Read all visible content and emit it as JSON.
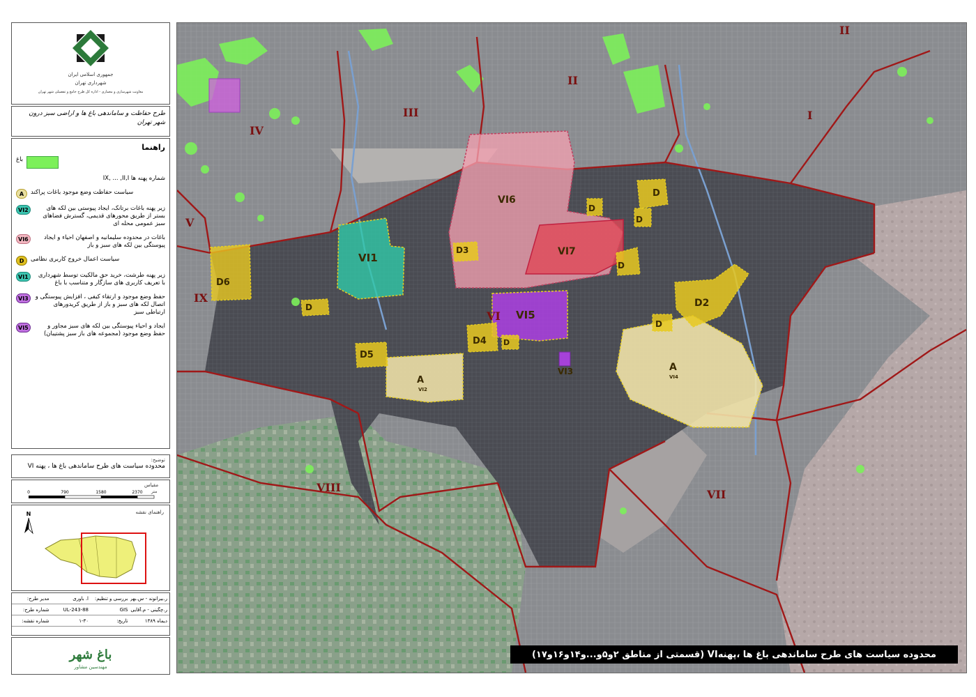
{
  "legend": {
    "logo_lines": [
      "جمهوری اسلامی ایران",
      "شهرداری تهران",
      "معاونت شهرسازی و معماری - اداره کل طرح جامع و تفصیلی شهر تهران"
    ],
    "plan_title": "طرح حفاظت و ساماندهی باغ ها و اراضی سبز درون شهر تهران",
    "heading": "راهنما",
    "garden_label": "باغ",
    "zone_numbers_label": "IX, ... ,II,I  شماره پهنه ها",
    "items": [
      {
        "code": "A",
        "text": "سیاست حفاظت وضع موجود باغات پراکند",
        "color": "#e8dfa0",
        "border": "#b8a030"
      },
      {
        "code": "VI2",
        "text": "زیر پهنه باغات برتانک، ایجاد پیوستی بین لکه های بستر از طریق محورهای قدیمی، گسترش فضاهای سبز عمومی محله ای",
        "color": "#3cc4b0",
        "border": "#1a8a7a"
      },
      {
        "code": "VI6",
        "text": "باغات در محدوده سلیمانیه و اصفهان احیاء و ایجاد پیوستگی بین لکه های سبز و باز",
        "color": "#f2b6c0",
        "border": "#c07080"
      },
      {
        "code": "D",
        "text": "سیاست اعمال خروج کاربری نظامی",
        "color": "#e0c020",
        "border": "#907a00"
      },
      {
        "code": "VI1",
        "text": "زیر پهنه طرشت، خرید حق مالکیت توسط شهرداری با تعریف کاربری های سازگار و متناسب با باغ",
        "color": "#3cc4b0",
        "border": "#1a8a7a"
      },
      {
        "code": "VI3",
        "text": "حفظ وضع موجود و ارتقاء کیفی ، افزایش پیوستگی و اتصال لکه های سبز و باز از طریق کریدورهای ارتباطی سبز",
        "color": "#c070e0",
        "border": "#6a2a90"
      },
      {
        "code": "VI5",
        "text": "ایجاد و احیاء پیوستگی بین لکه های سبز مجاور و حفظ وضع موجود (مجموعه های باز سبز پشتیبان)",
        "color": "#c070e0",
        "border": "#6a2a90"
      }
    ],
    "note_title": "توضیح:",
    "note_text": "محدوده سیاست های طرح ساماندهی باغ ها ، پهنه VI",
    "scale_title": "مقیاس",
    "scale_ticks": [
      "0",
      "790",
      "1580",
      "2370"
    ],
    "scale_unit": "متر",
    "key_map_title": "راهنمای نقشه",
    "north_label": "N",
    "meta": [
      {
        "k": "مدیر طرح:",
        "v": "ا. باوری",
        "k2": "بررسی و تنظیم:",
        "v2": "ر.بیرانوند - س.بهرامی‌زاده"
      },
      {
        "k": "شماره طرح:",
        "v": "243-88-UL",
        "k2": "GIS",
        "v2": "ر.چگینی - م.آقایی"
      },
      {
        "k": "شماره نقشه:",
        "v": "۱-۳۰",
        "k2": "تاریخ:",
        "v2": "دیماه ۱۳۸۹"
      }
    ],
    "firm_name": "باغ شهر",
    "firm_sub": "مهندسین مشاور"
  },
  "map": {
    "caption": "محدوده سیاست های طرح ساماندهی باغ ها ،پهنهVI (قسمتی از مناطق ۲و۵و...و۱۴و۱۶و۱۷)",
    "colors": {
      "boundary": "#a01818",
      "garden": "#7cf05a",
      "pink": "#f2a0b0",
      "red": "#e04858",
      "teal": "#30c8a8",
      "purple": "#b040e8",
      "yellow": "#e8c820",
      "beige": "#f0e2a8"
    },
    "zone_labels": [
      {
        "text": "I"
      },
      {
        "text": "II"
      },
      {
        "text": "II"
      },
      {
        "text": "III"
      },
      {
        "text": "IV"
      },
      {
        "text": "V"
      },
      {
        "text": "VI"
      },
      {
        "text": "VII"
      },
      {
        "text": "VIII"
      },
      {
        "text": "IX"
      }
    ],
    "sub_labels": {
      "VI1": "VI1",
      "VI6": "VI6",
      "VI7": "VI7",
      "VI5": "VI5",
      "VI3": "VI3",
      "D": "D",
      "D2": "D2",
      "D3": "D3",
      "D4": "D4",
      "D5": "D5",
      "D6": "D6",
      "A": "A",
      "A_sub_1": "VI2",
      "A_sub_2": "VI4"
    }
  }
}
